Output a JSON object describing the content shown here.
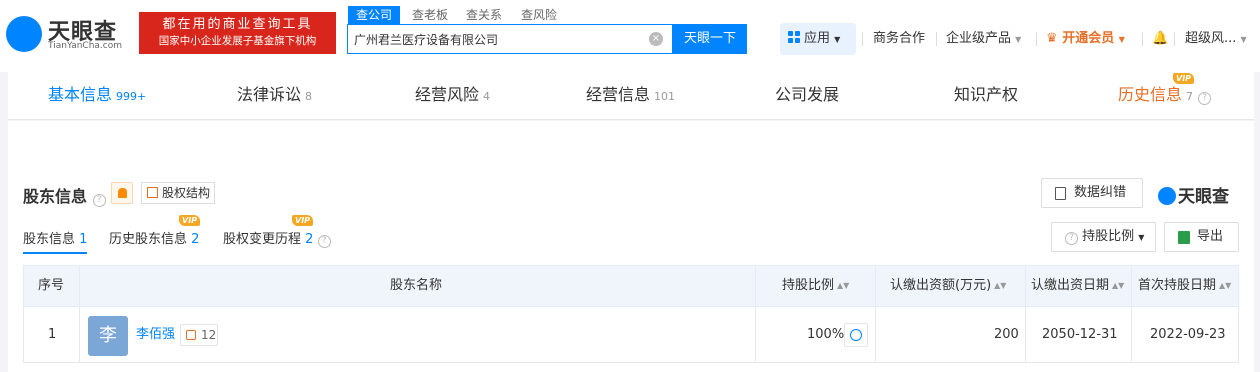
{
  "brand": {
    "name": "天眼查",
    "site": "TianYanCha.com",
    "slogan_line1": "都在用的商业查询工具",
    "slogan_line2": "国家中小企业发展子基金旗下机构"
  },
  "search": {
    "tabs": [
      "查公司",
      "查老板",
      "查关系",
      "查风险"
    ],
    "active_tab": "查公司",
    "query": "广州君兰医疗设备有限公司",
    "button": "天眼一下"
  },
  "nav": {
    "app": "应用",
    "items": [
      "商务合作",
      "企业级产品",
      "开通会员",
      "超级风..."
    ]
  },
  "tabs": [
    {
      "label": "基本信息",
      "count": "999+"
    },
    {
      "label": "法律诉讼",
      "count": "8"
    },
    {
      "label": "经营风险",
      "count": "4"
    },
    {
      "label": "经营信息",
      "count": "101"
    },
    {
      "label": "公司发展",
      "count": ""
    },
    {
      "label": "知识产权",
      "count": ""
    },
    {
      "label": "历史信息",
      "count": "7"
    }
  ],
  "vip_label": "VIP",
  "section": {
    "title": "股东信息",
    "structure_btn": "股权结构",
    "correct_btn": "数据纠错",
    "watermark": "天眼查",
    "ratio_btn": "持股比例",
    "export_btn": "导出"
  },
  "subtabs": [
    {
      "label": "股东信息",
      "count": "1"
    },
    {
      "label": "历史股东信息",
      "count": "2"
    },
    {
      "label": "股权变更历程",
      "count": "2"
    }
  ],
  "table": {
    "headers": [
      "序号",
      "股东名称",
      "持股比例",
      "认缴出资额(万元)",
      "认缴出资日期",
      "首次持股日期"
    ],
    "rows": [
      {
        "index": "1",
        "avatar": "李",
        "name": "李佰强",
        "relations": "12",
        "ratio": "100%",
        "amount": "200",
        "date": "2050-12-31",
        "first_date": "2022-09-23"
      }
    ]
  },
  "colors": {
    "accent": "#0084ff",
    "brand_red": "#d9261c",
    "vip": "#f5a623",
    "member": "#e86f27"
  }
}
